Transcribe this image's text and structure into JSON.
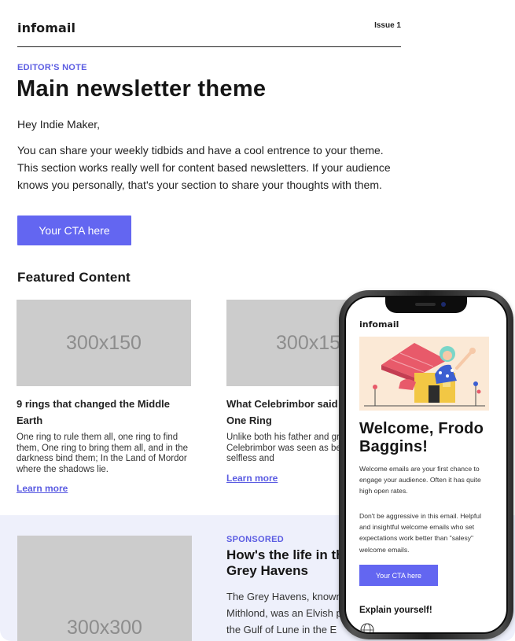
{
  "header": {
    "logo": "infomail",
    "issue": "Issue 1"
  },
  "editor_note": {
    "eyebrow": "EDITOR'S NOTE",
    "title": "Main newsletter theme",
    "greeting": "Hey Indie Maker,",
    "body": "You can share your weekly tidbids and have a cool entrence to your theme. This section works really well for content based newsletters. If your audience knows you personally, that's your section to share your thoughts with them.",
    "cta_label": "Your CTA here"
  },
  "featured": {
    "title": "Featured Content",
    "cards": [
      {
        "placeholder": "300x150",
        "title": "9 rings that changed the Middle Earth",
        "desc": "One ring to rule them all, one ring to find them, One ring to bring them all, and in the darkness bind them; In the Land of Mordor where the shadows lie.",
        "link": "Learn more"
      },
      {
        "placeholder": "300x150",
        "title": "What Celebrimbor said about The One Ring",
        "desc": "Unlike both his father and grandfather, Celebrimbor was seen as being both selfless and",
        "link": "Learn more"
      }
    ]
  },
  "sponsored": {
    "placeholder": "300x300",
    "eyebrow": "SPONSORED",
    "title": "How's the life in the Grey Havens",
    "body": "The Grey Havens, known as Mithlond, was an Elvish port on the Gulf of Lune in the E"
  },
  "phone": {
    "logo": "infomail",
    "welcome": "Welcome, Frodo Baggins!",
    "text1": "Welcome emails are your first chance to engage your audience. Often it has quite high open rates.",
    "text2": "Don't be aggressive in this email. Helpful and insightful welcome emails who set expectations work better than \"salesy\" welcome emails.",
    "cta_label": "Your CTA here",
    "explain": "Explain yourself!"
  },
  "colors": {
    "accent": "#6366f1",
    "placeholder": "#cccccc",
    "sponsored_bg": "#eef0fb"
  }
}
